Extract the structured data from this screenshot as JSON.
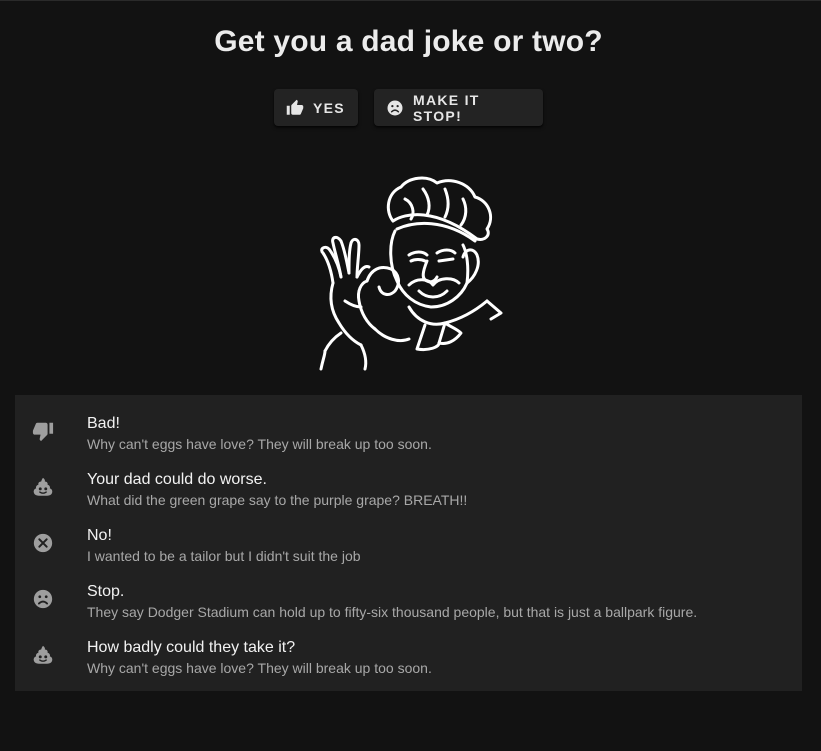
{
  "header": {
    "title": "Get you a dad joke or two?"
  },
  "buttons": {
    "yes": {
      "label": "YES",
      "icon": "thumb-up-icon"
    },
    "stop": {
      "label": "MAKE IT STOP!",
      "icon": "sad-face-icon"
    }
  },
  "illustration": {
    "icon": "chef-kiss-icon"
  },
  "jokes": [
    {
      "title": "Bad!",
      "text": "Why can't eggs have love? They will break up too soon.",
      "icon": "thumb-down-icon"
    },
    {
      "title": "Your dad could do worse.",
      "text": "What did the green grape say to the purple grape? BREATH!!",
      "icon": "poop-icon"
    },
    {
      "title": "No!",
      "text": "I wanted to be a tailor but I didn't suit the job",
      "icon": "cancel-icon"
    },
    {
      "title": "Stop.",
      "text": "They say Dodger Stadium can hold up to fifty-six thousand people, but that is just a ballpark figure.",
      "icon": "sad-face-icon"
    },
    {
      "title": "How badly could they take it?",
      "text": "Why can't eggs have love? They will break up too soon.",
      "icon": "poop-icon"
    }
  ],
  "colors": {
    "background": "#121212",
    "surface": "#212121",
    "button": "#232323",
    "text_primary": "#f2f2f2",
    "text_secondary": "#a8a8a8",
    "icon": "#9e9e9e"
  }
}
